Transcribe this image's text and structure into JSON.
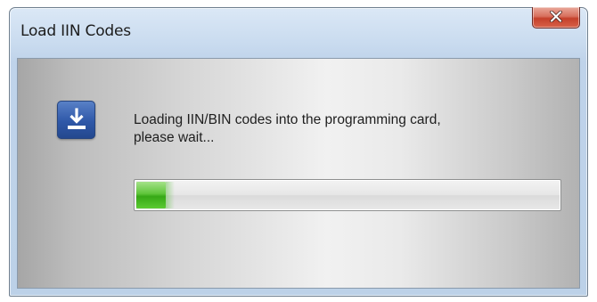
{
  "window": {
    "title": "Load IIN Codes"
  },
  "close_button": {
    "icon": "close-icon"
  },
  "dialog": {
    "icon": "download-icon",
    "message_line1": "Loading IIN/BIN codes into the programming card,",
    "message_line2": "please wait..."
  },
  "progress": {
    "value_percent": 7
  },
  "colors": {
    "progress_fill": "#4cbb24",
    "close_button": "#c8432e",
    "icon_background": "#2f58a8"
  }
}
